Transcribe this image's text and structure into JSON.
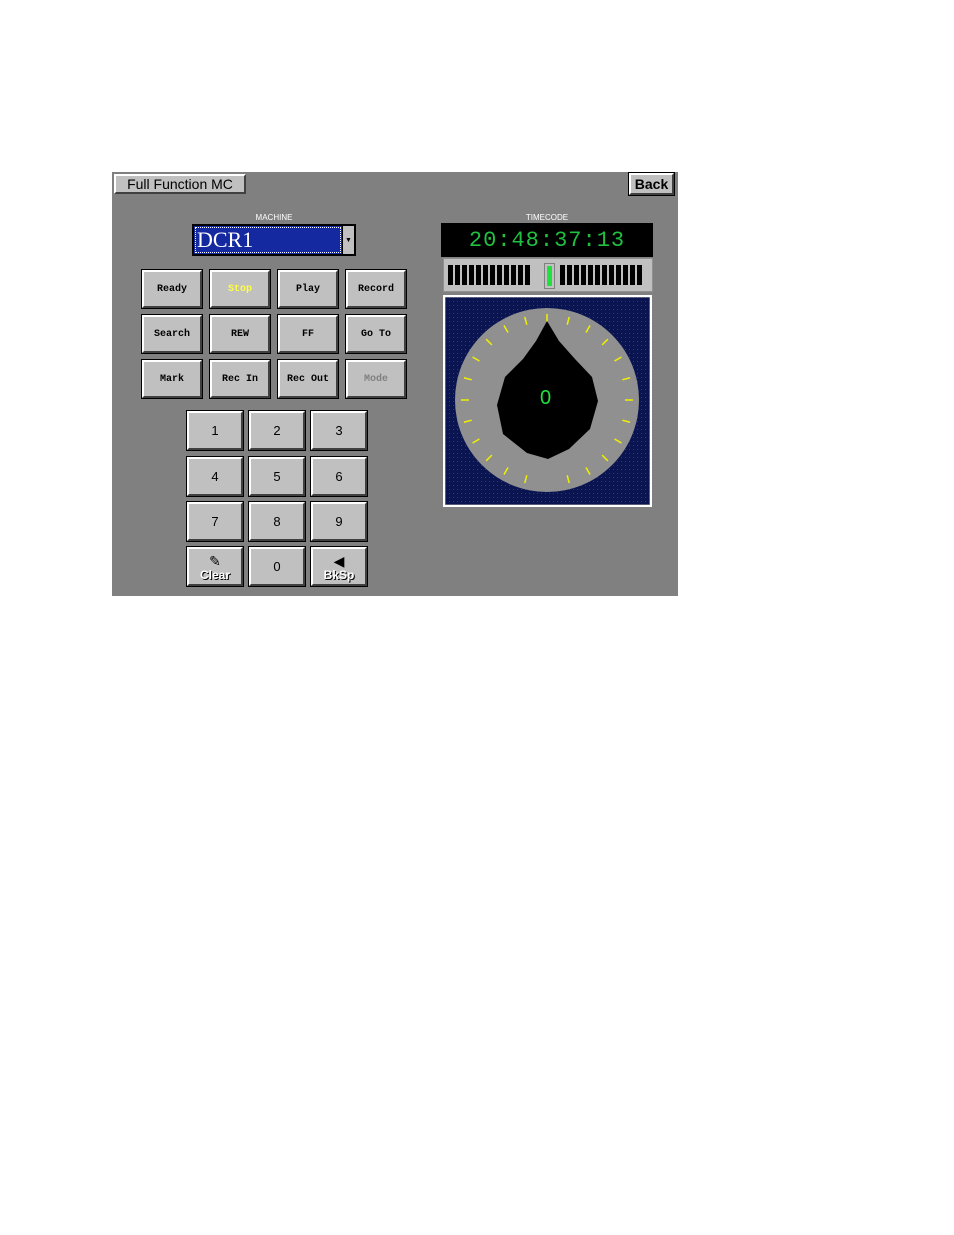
{
  "window": {
    "title": "Full Function MC",
    "back_label": "Back"
  },
  "machine": {
    "label": "MACHINE",
    "value": "DCR1",
    "dropdown_icon": "chevron-down-icon"
  },
  "timecode": {
    "label": "TIMECODE",
    "value": "20:48:37:13"
  },
  "transport": [
    {
      "id": "ready",
      "label": "Ready",
      "active": false,
      "disabled": false
    },
    {
      "id": "stop",
      "label": "Stop",
      "active": true,
      "disabled": false
    },
    {
      "id": "play",
      "label": "Play",
      "active": false,
      "disabled": false
    },
    {
      "id": "record",
      "label": "Record",
      "active": false,
      "disabled": false
    },
    {
      "id": "search",
      "label": "Search",
      "active": false,
      "disabled": false
    },
    {
      "id": "rew",
      "label": "REW",
      "active": false,
      "disabled": false
    },
    {
      "id": "ff",
      "label": "FF",
      "active": false,
      "disabled": false
    },
    {
      "id": "goto",
      "label": "Go To",
      "active": false,
      "disabled": false
    },
    {
      "id": "mark",
      "label": "Mark",
      "active": false,
      "disabled": false
    },
    {
      "id": "recin",
      "label": "Rec In",
      "active": false,
      "disabled": false
    },
    {
      "id": "recout",
      "label": "Rec Out",
      "active": false,
      "disabled": false
    },
    {
      "id": "mode",
      "label": "Mode",
      "active": false,
      "disabled": true
    }
  ],
  "keypad": [
    {
      "id": "1",
      "label": "1"
    },
    {
      "id": "2",
      "label": "2"
    },
    {
      "id": "3",
      "label": "3"
    },
    {
      "id": "4",
      "label": "4"
    },
    {
      "id": "5",
      "label": "5"
    },
    {
      "id": "6",
      "label": "6"
    },
    {
      "id": "7",
      "label": "7"
    },
    {
      "id": "8",
      "label": "8"
    },
    {
      "id": "9",
      "label": "9"
    },
    {
      "id": "clear",
      "label": "Clear",
      "icon": "broom-icon"
    },
    {
      "id": "0",
      "label": "0"
    },
    {
      "id": "bksp",
      "label": "BkSp",
      "icon": "left-arrow-icon"
    }
  ],
  "jog": {
    "readout": "0"
  },
  "colors": {
    "panel": "#808080",
    "active_text": "#ffff40",
    "disabled_text": "#808080",
    "timecode": "#20c040",
    "jog_background": "#0a1450"
  }
}
